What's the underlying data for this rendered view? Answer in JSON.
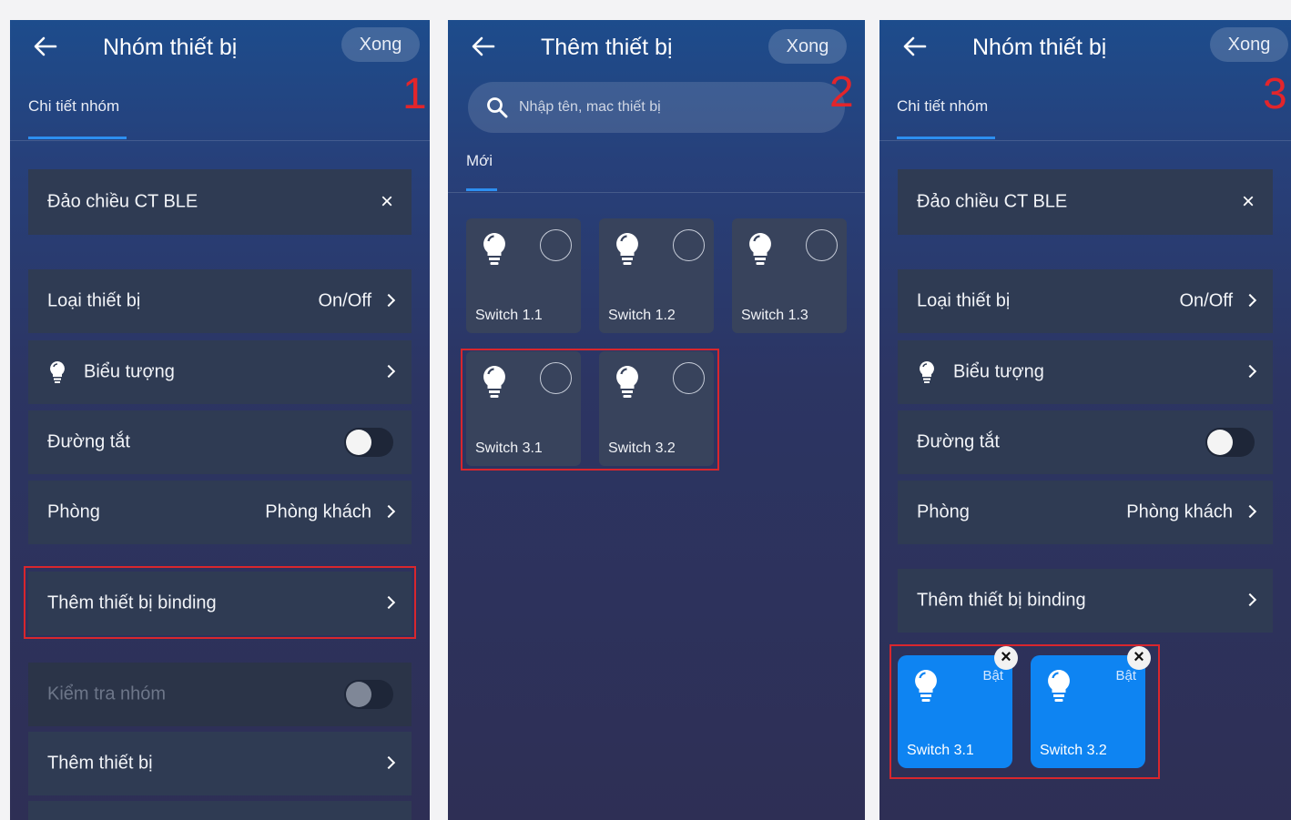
{
  "panel1": {
    "title": "Nhóm thiết bị",
    "done": "Xong",
    "step": "1",
    "tab": "Chi tiết nhóm",
    "group_name": "Đảo chiều CT BLE",
    "close": "×",
    "device_type_label": "Loại thiết bị",
    "device_type_value": "On/Off",
    "icon_label": "Biểu tượng",
    "shortcut_label": "Đường tắt",
    "room_label": "Phòng",
    "room_value": "Phòng khách",
    "binding_label": "Thêm thiết bị binding",
    "test_group_label": "Kiểm tra nhóm",
    "add_device_label": "Thêm thiết bị"
  },
  "panel2": {
    "title": "Thêm thiết bị",
    "done": "Xong",
    "step": "2",
    "search_placeholder": "Nhập tên, mac thiết bị",
    "tab": "Mới",
    "devices": [
      "Switch 1.1",
      "Switch 1.2",
      "Switch 1.3",
      "Switch 3.1",
      "Switch 3.2"
    ]
  },
  "panel3": {
    "title": "Nhóm thiết bị",
    "done": "Xong",
    "step": "3",
    "tab": "Chi tiết nhóm",
    "group_name": "Đảo chiều CT BLE",
    "close": "×",
    "device_type_label": "Loại thiết bị",
    "device_type_value": "On/Off",
    "icon_label": "Biểu tượng",
    "shortcut_label": "Đường tắt",
    "room_label": "Phòng",
    "room_value": "Phòng khách",
    "binding_label": "Thêm thiết bị binding",
    "bound_devices": [
      {
        "name": "Switch 3.1",
        "state": "Bật",
        "remove": "×"
      },
      {
        "name": "Switch 3.2",
        "state": "Bật",
        "remove": "×"
      }
    ]
  },
  "colors": {
    "highlight": "#d9262d",
    "accent": "#2d8ff0",
    "device_card_active": "#0e84f2"
  }
}
